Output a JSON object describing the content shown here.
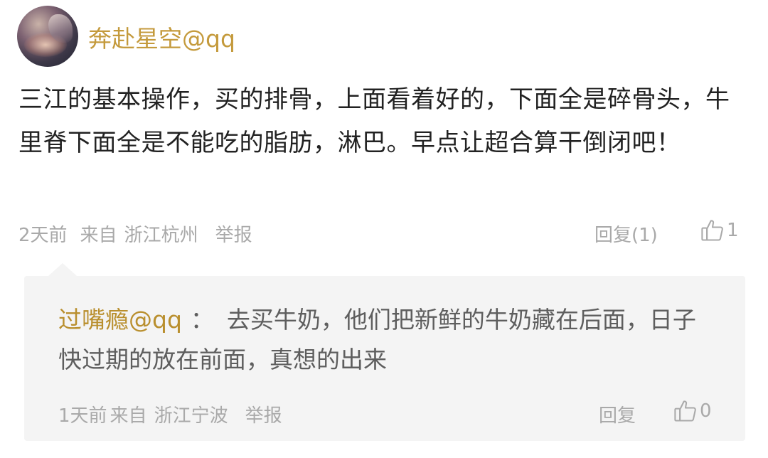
{
  "post": {
    "username": "奔赴星空@qq",
    "content": "三江的基本操作，买的排骨，上面看着好的，下面全是碎骨头，牛里脊下面全是不能吃的脂肪，淋巴。早点让超合算干倒闭吧！",
    "time": "2天前",
    "from": "来自",
    "location": "浙江杭州",
    "report": "举报",
    "reply_label": "回复(1)",
    "like_count": "1"
  },
  "reply": {
    "username": "过嘴瘾@qq",
    "separator": "：",
    "content": "去买牛奶，他们把新鲜的牛奶藏在后面，日子快过期的放在前面，真想的出来",
    "time": "1天前",
    "from": "来自",
    "location": "浙江宁波",
    "report": "举报",
    "reply_label": "回复",
    "like_count": "0"
  },
  "icons": {
    "avatar": "avatar-image",
    "like": "thumbs-up-icon"
  },
  "colors": {
    "username": "#c49a3c",
    "reply_username": "#b98f2e",
    "meta": "#a9a9a9",
    "reply_bg": "#f4f4f4"
  }
}
